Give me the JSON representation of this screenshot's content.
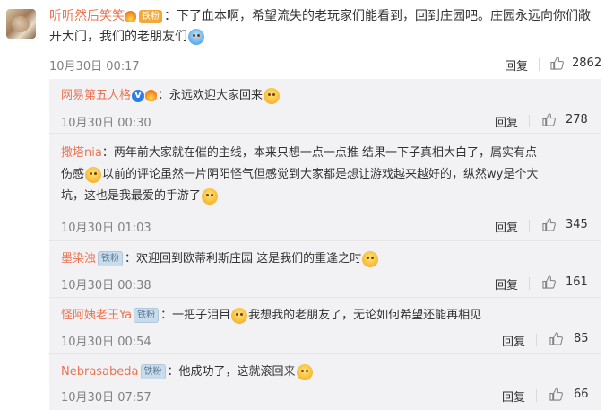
{
  "main_comment": {
    "username": "听听然后笑笑",
    "badge": "铁粉",
    "colon": "：",
    "text": "下了血本啊，希望流失的老玩家们能看到，回到庄园吧。庄园永远向你们敞开大门，我们的老朋友们",
    "date": "10月30日 00:17",
    "reply_label": "回复",
    "likes": "2862"
  },
  "replies": [
    {
      "username": "网易第五人格",
      "verified": "V",
      "colon": "：",
      "text": "永远欢迎大家回来",
      "date": "10月30日 00:30",
      "reply_label": "回复",
      "likes": "278"
    },
    {
      "username": "撒塔nia",
      "colon": "：",
      "text_line1": "两年前大家就在催的主线，本来只想一点一点推 结果一下子真相大白了，属实有点",
      "text_line2a": "伤感",
      "text_line2b": "以前的评论虽然一片阴阳怪气但感觉到大家都是想让游戏越来越好的，纵然wy是个大",
      "text_line3": "坑，这也是我最爱的手游了",
      "date": "10月30日 01:03",
      "reply_label": "回复",
      "likes": "345"
    },
    {
      "username": "墨染浊",
      "badge": "铁粉",
      "colon": "：",
      "text": "欢迎回到欧蒂利斯庄园 这是我们的重逢之时",
      "date": "10月30日 00:38",
      "reply_label": "回复",
      "likes": "161"
    },
    {
      "username": "怪阿姨老王Ya",
      "badge": "铁粉",
      "colon": "：",
      "text_a": "一把子泪目",
      "text_b": "我想我的老朋友了，无论如何希望还能再相见",
      "date": "10月30日 00:54",
      "reply_label": "回复",
      "likes": "85"
    },
    {
      "username": "Nebrasabeda",
      "badge": "铁粉",
      "colon": "：",
      "text": "他成功了，这就滚回来",
      "date": "10月30日 07:57",
      "reply_label": "回复",
      "likes": "66"
    }
  ],
  "icons": {
    "like": "thumbs-up-icon",
    "fire": "fire-badge-icon",
    "emoji": "emoji-icon"
  },
  "colors": {
    "username": "#eb7350",
    "reply_bg": "#f2f2f5",
    "verified": "#2b7de9",
    "gold_badge": "#f2a93b"
  }
}
